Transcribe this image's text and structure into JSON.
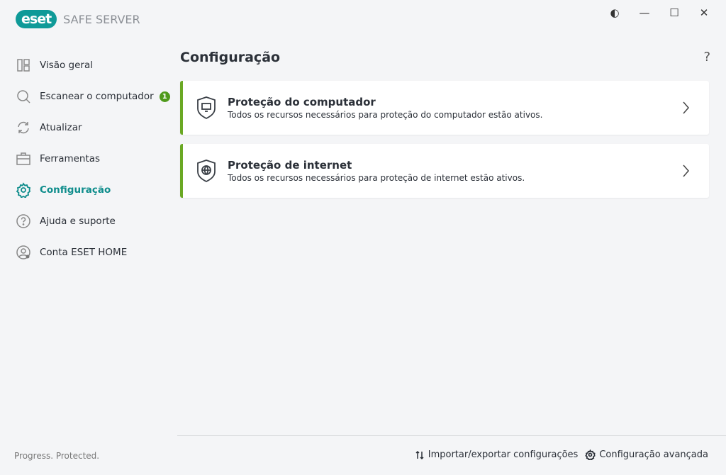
{
  "app": {
    "logo": "eset",
    "product": "SAFE SERVER",
    "tagline": "Progress. Protected."
  },
  "window": {
    "theme": "◐",
    "minimize": "—",
    "maximize": "☐",
    "close": "✕"
  },
  "sidebar": {
    "items": [
      {
        "label": "Visão geral",
        "icon": "dashboard-icon"
      },
      {
        "label": "Escanear o computador",
        "icon": "search-icon",
        "badge": "1"
      },
      {
        "label": "Atualizar",
        "icon": "refresh-icon"
      },
      {
        "label": "Ferramentas",
        "icon": "briefcase-icon"
      },
      {
        "label": "Configuração",
        "icon": "gear-icon",
        "active": true
      },
      {
        "label": "Ajuda e suporte",
        "icon": "help-icon"
      },
      {
        "label": "Conta ESET HOME",
        "icon": "account-icon"
      }
    ]
  },
  "main": {
    "title": "Configuração",
    "help": "?",
    "cards": [
      {
        "title": "Proteção do computador",
        "desc": "Todos os recursos necessários para proteção do computador estão ativos.",
        "icon": "shield-computer-icon"
      },
      {
        "title": "Proteção de internet",
        "desc": "Todos os recursos necessários para proteção de internet estão ativos.",
        "icon": "shield-globe-icon"
      }
    ]
  },
  "footer": {
    "import_export": "Importar/exportar configurações",
    "advanced": "Configuração avançada"
  },
  "colors": {
    "accent": "#0f9a98",
    "status": "#6aa823"
  }
}
